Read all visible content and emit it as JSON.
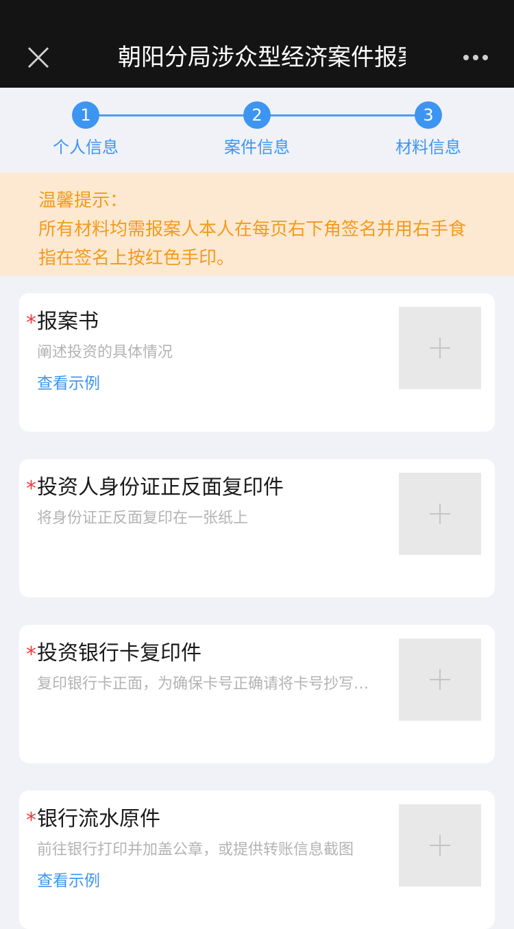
{
  "header": {
    "title": "朝阳分局涉众型经济案件报案",
    "close_icon": "close-icon",
    "more_icon": "more-dots-icon"
  },
  "steps": [
    {
      "number": "1",
      "label": "个人信息"
    },
    {
      "number": "2",
      "label": "案件信息"
    },
    {
      "number": "3",
      "label": "材料信息"
    }
  ],
  "notice": {
    "heading": "温馨提示：",
    "body": "所有材料均需报案人本人在每页右下角签名并用右手食指在签名上按红色手印。"
  },
  "cards": [
    {
      "required": "*",
      "title": "报案书",
      "desc": "阐述投资的具体情况",
      "link": "查看示例"
    },
    {
      "required": "*",
      "title": "投资人身份证正反面复印件",
      "desc": "将身份证正反面复印在一张纸上",
      "link": ""
    },
    {
      "required": "*",
      "title": "投资银行卡复印件",
      "desc": "复印银行卡正面，为确保卡号正确请将卡号抄写在复印件上",
      "link": ""
    },
    {
      "required": "*",
      "title": "银行流水原件",
      "desc": "前往银行打印并加盖公章，或提供转账信息截图",
      "link": "查看示例"
    }
  ],
  "colors": {
    "accent": "#3d95f2",
    "required": "#f03a3a",
    "notice_text": "#f39a1b",
    "notice_bg": "#fde9d2"
  }
}
